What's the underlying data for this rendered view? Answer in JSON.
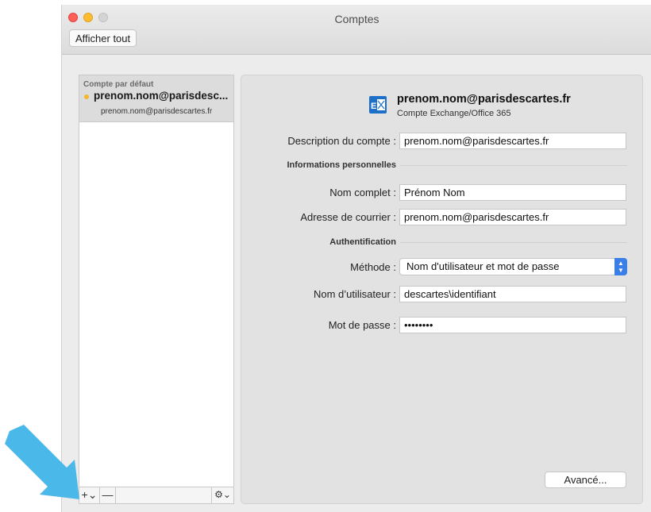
{
  "window": {
    "title": "Comptes",
    "show_all_label": "Afficher tout"
  },
  "sidebar": {
    "group_label": "Compte par défaut",
    "account": {
      "name": "prenom.nom@parisdesc...",
      "email": "prenom.nom@parisdescartes.fr",
      "status_color": "#f3b72c"
    },
    "toolbar": {
      "add_label": "+⌄",
      "remove_label": "—",
      "gear_label": "⚙⌄"
    }
  },
  "account": {
    "title": "prenom.nom@parisdescartes.fr",
    "type": "Compte Exchange/Office 365",
    "icon": "exchange-icon"
  },
  "form": {
    "description_label": "Description du compte :",
    "description_value": "prenom.nom@parisdescartes.fr",
    "personal_section": "Informations personnelles",
    "fullname_label": "Nom complet :",
    "fullname_value": "Prénom Nom",
    "email_label": "Adresse de courrier :",
    "email_value": "prenom.nom@parisdescartes.fr",
    "auth_section": "Authentification",
    "method_label": "Méthode :",
    "method_value": "Nom d'utilisateur et mot de passe",
    "username_label": "Nom d’utilisateur :",
    "username_value": "descartes\\identifiant",
    "password_label": "Mot de passe :",
    "password_value": "••••••••",
    "advanced_label": "Avancé..."
  },
  "colors": {
    "accent": "#3a7ee8",
    "annotation_arrow": "#4ab8e8"
  }
}
